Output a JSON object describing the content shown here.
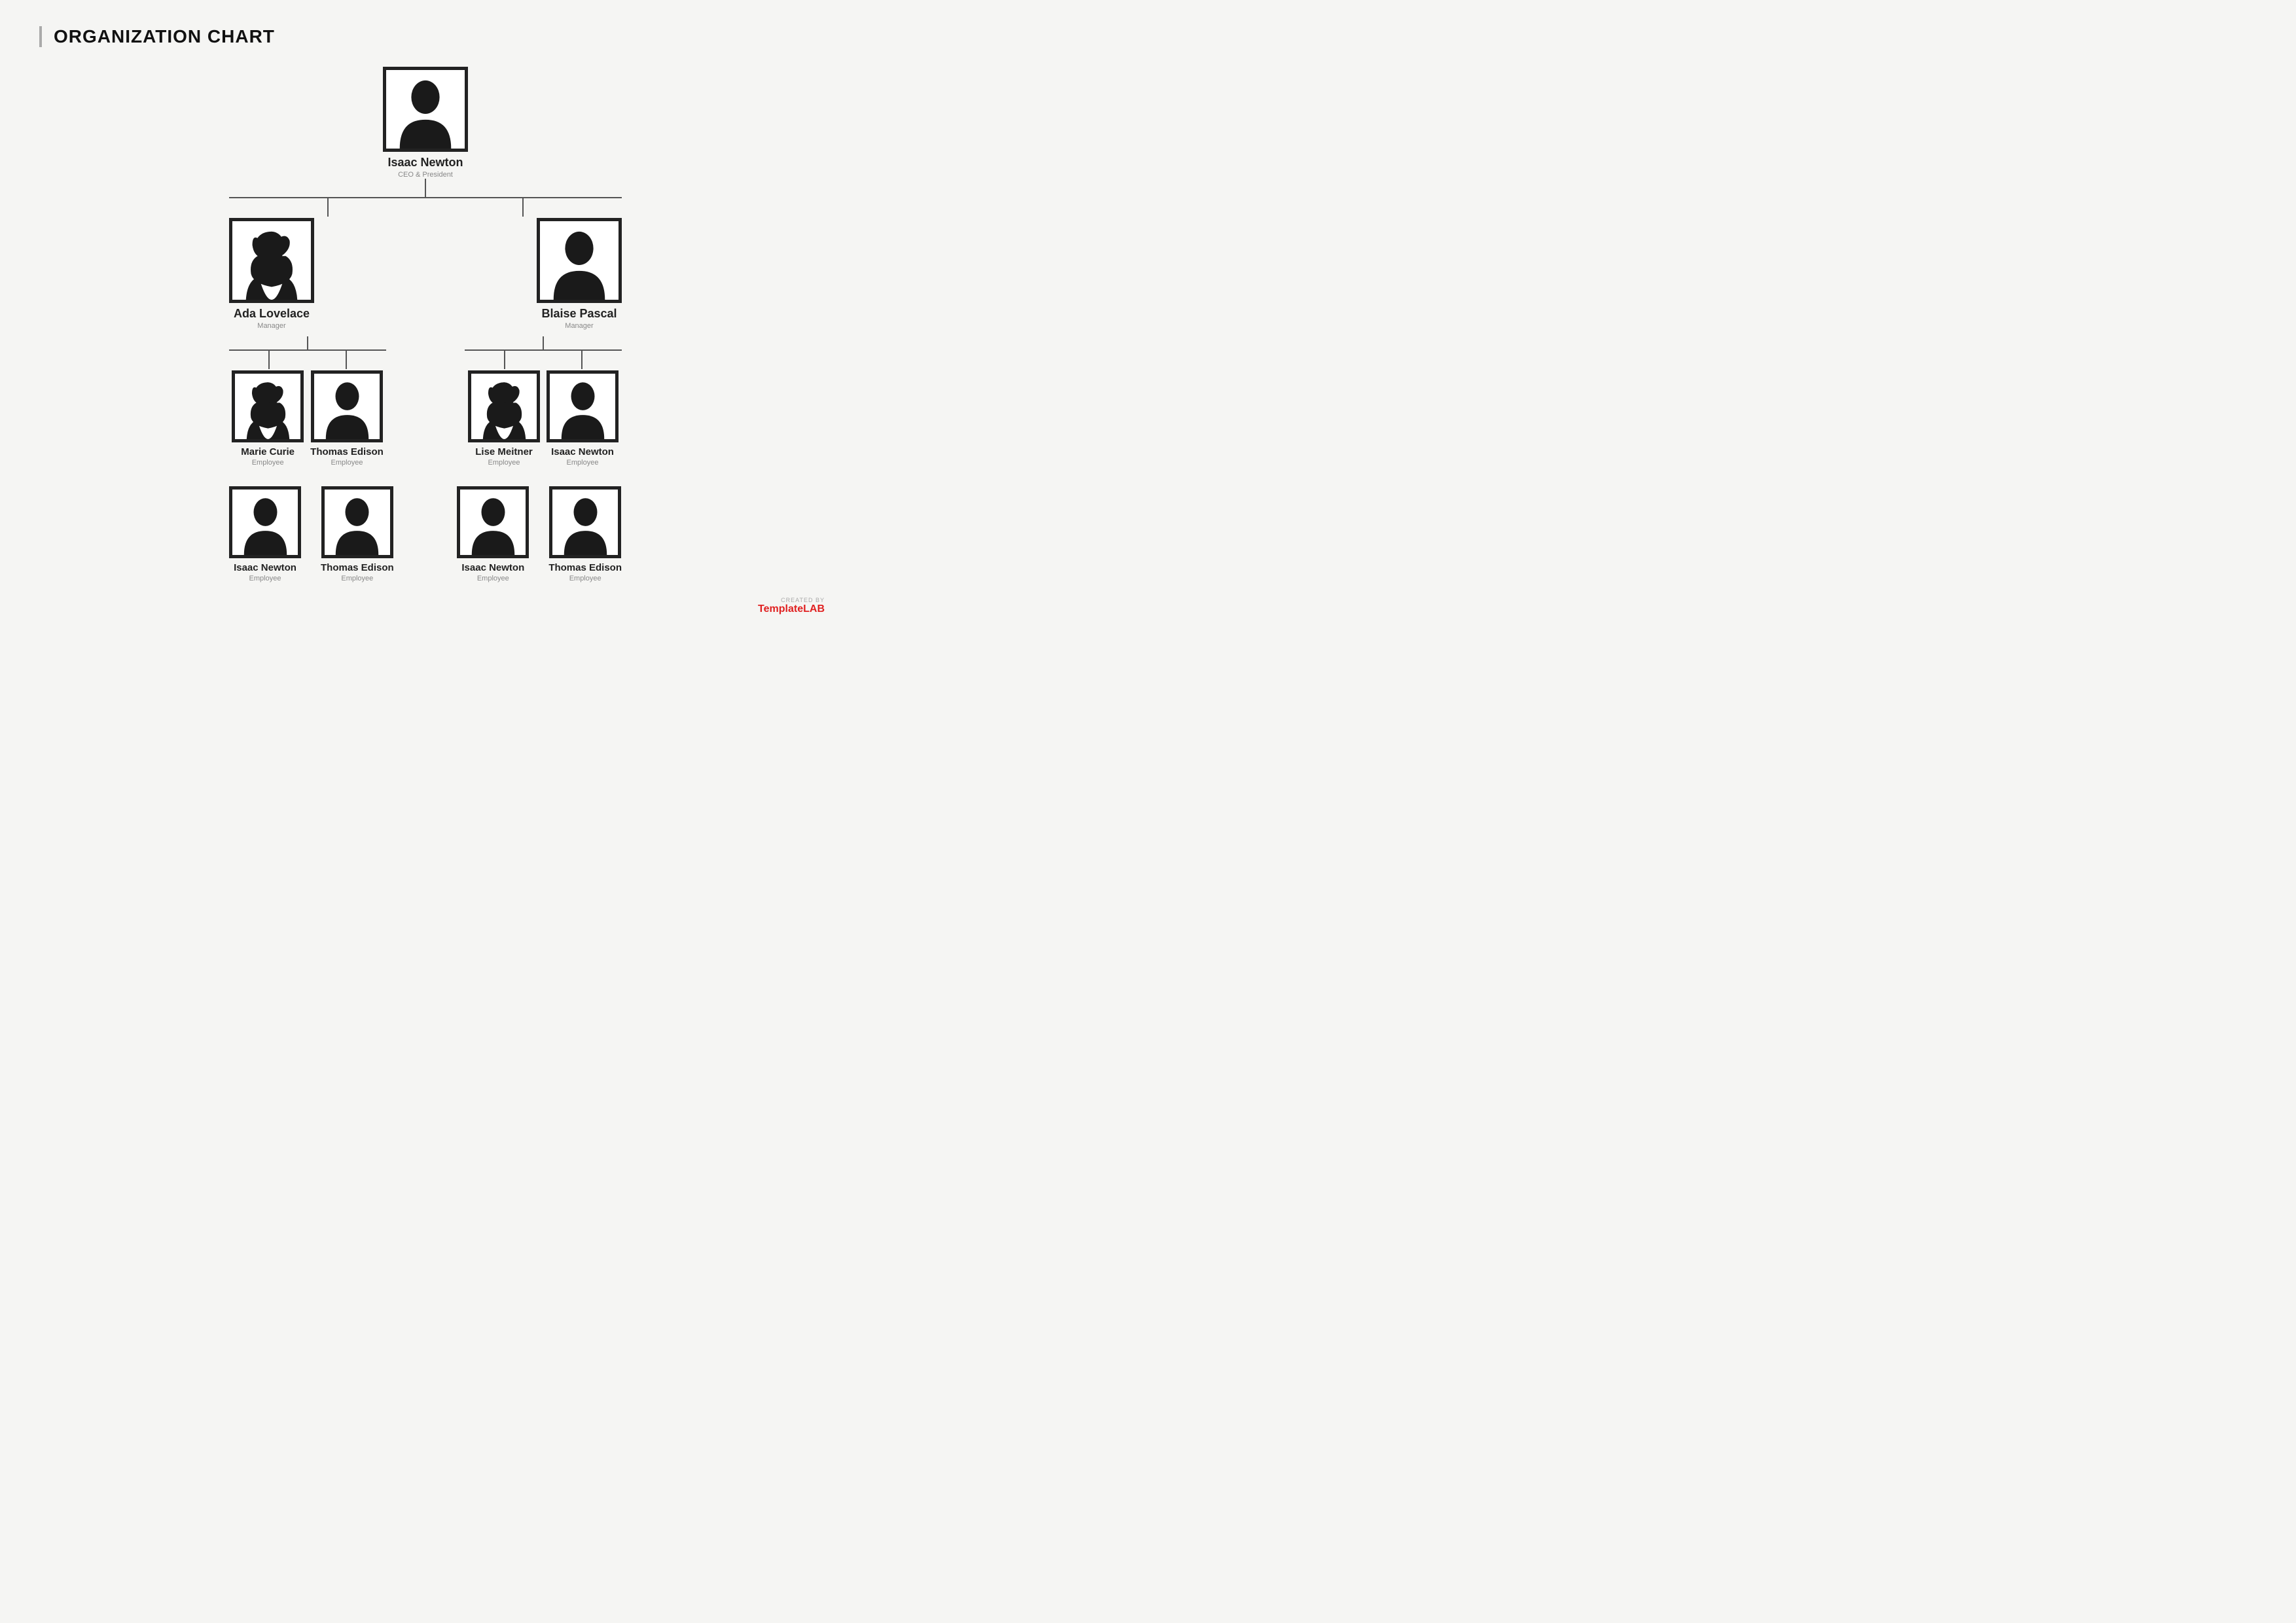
{
  "title": "ORGANIZATION CHART",
  "chart": {
    "ceo": {
      "name": "Isaac Newton",
      "role": "CEO & President",
      "gender": "m"
    },
    "managers": [
      {
        "name": "Ada Lovelace",
        "role": "Manager",
        "gender": "f",
        "employees": [
          {
            "name": "Marie Curie",
            "role": "Employee",
            "gender": "f"
          },
          {
            "name": "Thomas Edison",
            "role": "Employee",
            "gender": "m"
          }
        ]
      },
      {
        "name": "Blaise Pascal",
        "role": "Manager",
        "gender": "m",
        "employees": [
          {
            "name": "Lise Meitner",
            "role": "Employee",
            "gender": "f"
          },
          {
            "name": "Isaac Newton",
            "role": "Employee",
            "gender": "m"
          }
        ]
      }
    ],
    "bottom_row": [
      {
        "name": "Isaac Newton",
        "role": "Employee",
        "gender": "m"
      },
      {
        "name": "Thomas Edison",
        "role": "Employee",
        "gender": "m"
      },
      {
        "name": "Isaac Newton",
        "role": "Employee",
        "gender": "m"
      },
      {
        "name": "Thomas Edison",
        "role": "Employee",
        "gender": "m"
      }
    ]
  },
  "watermark": {
    "created_by": "CREATED BY",
    "brand_prefix": "Template",
    "brand_suffix": "LAB"
  }
}
